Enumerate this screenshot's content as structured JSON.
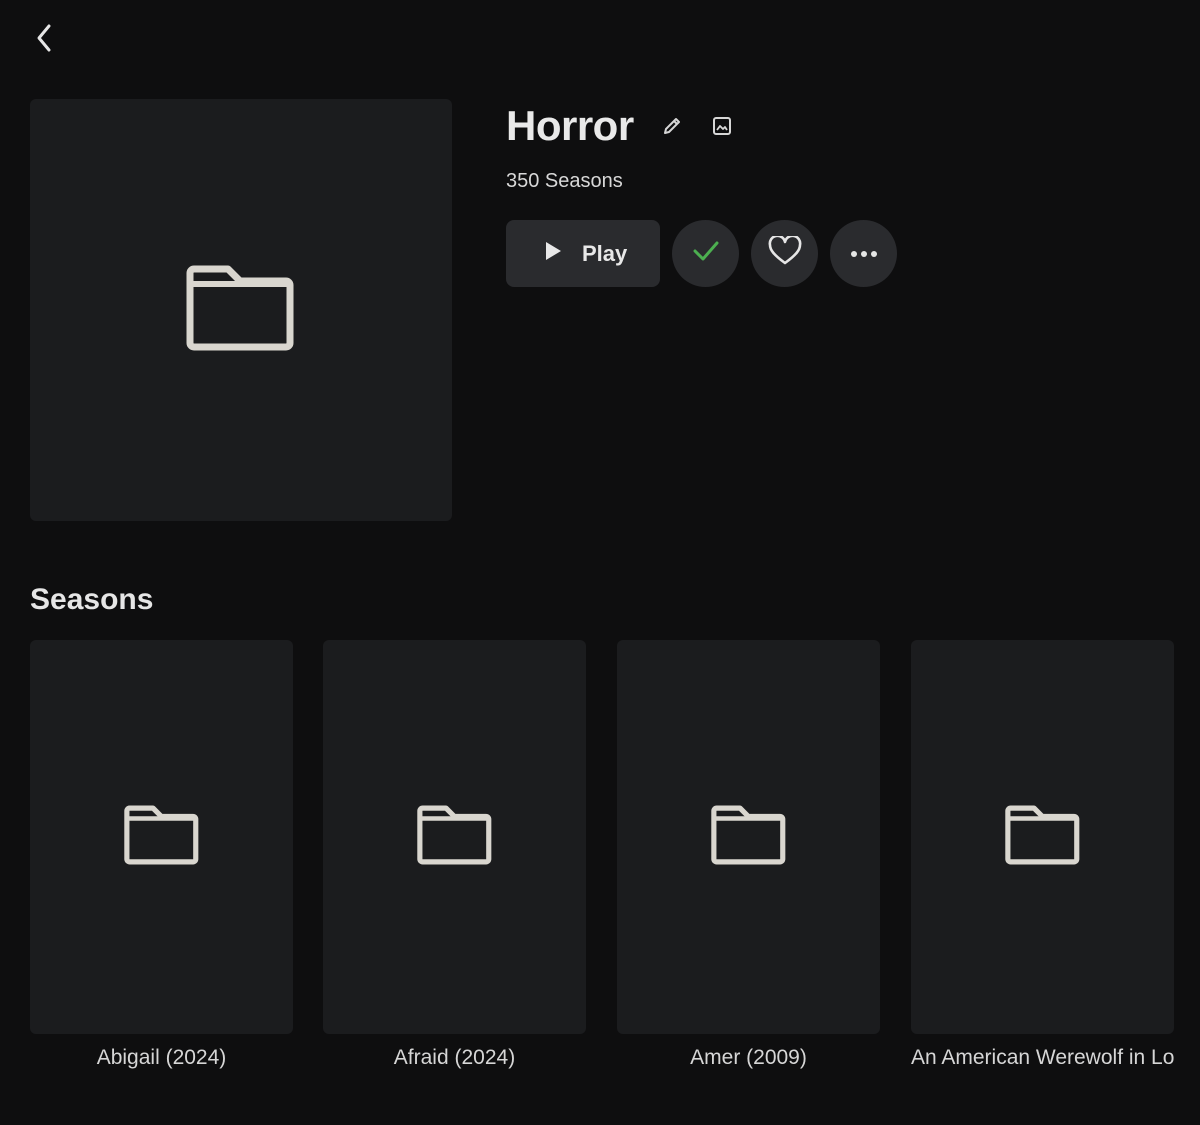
{
  "header": {
    "back_icon": "chevron-left-icon"
  },
  "collection": {
    "title": "Horror",
    "subtitle": "350 Seasons",
    "art_icon": "folder-icon",
    "edit_icon": "pencil-icon",
    "image_icon": "image-icon"
  },
  "actions": {
    "play_label": "Play",
    "play_icon": "play-icon",
    "watched_icon": "check-icon",
    "favorite_icon": "heart-icon",
    "more_icon": "more-icon"
  },
  "colors": {
    "background": "#0e0e0f",
    "card": "#1b1c1e",
    "button": "#2a2b2e",
    "check": "#4caf50"
  },
  "seasons": {
    "heading": "Seasons",
    "items": [
      {
        "label": "Abigail (2024)"
      },
      {
        "label": "Afraid (2024)"
      },
      {
        "label": "Amer (2009)"
      },
      {
        "label": "An American Werewolf in London"
      }
    ]
  }
}
